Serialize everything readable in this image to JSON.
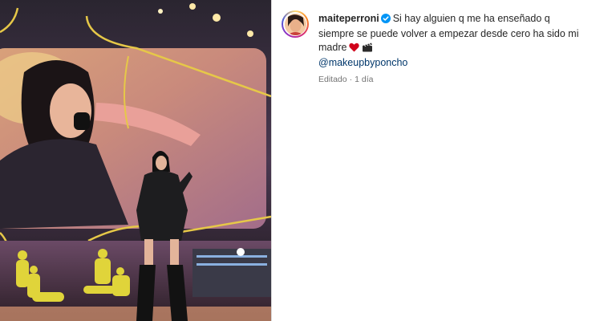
{
  "post": {
    "username": "maiteperroni",
    "verified": true,
    "caption_text": "Si hay alguien q me ha enseñado q siempre se puede volver a empezar desde cero ha sido mi madre",
    "caption_emojis": [
      "red-heart",
      "clapper-board"
    ],
    "mention": "@makeupbyponcho",
    "edited_label": "Editado",
    "separator": "·",
    "age": "1 día"
  },
  "colors": {
    "verified_badge": "#0095f6",
    "mention": "#00376b",
    "meta_text": "#737373",
    "heart": "#d0021b"
  }
}
